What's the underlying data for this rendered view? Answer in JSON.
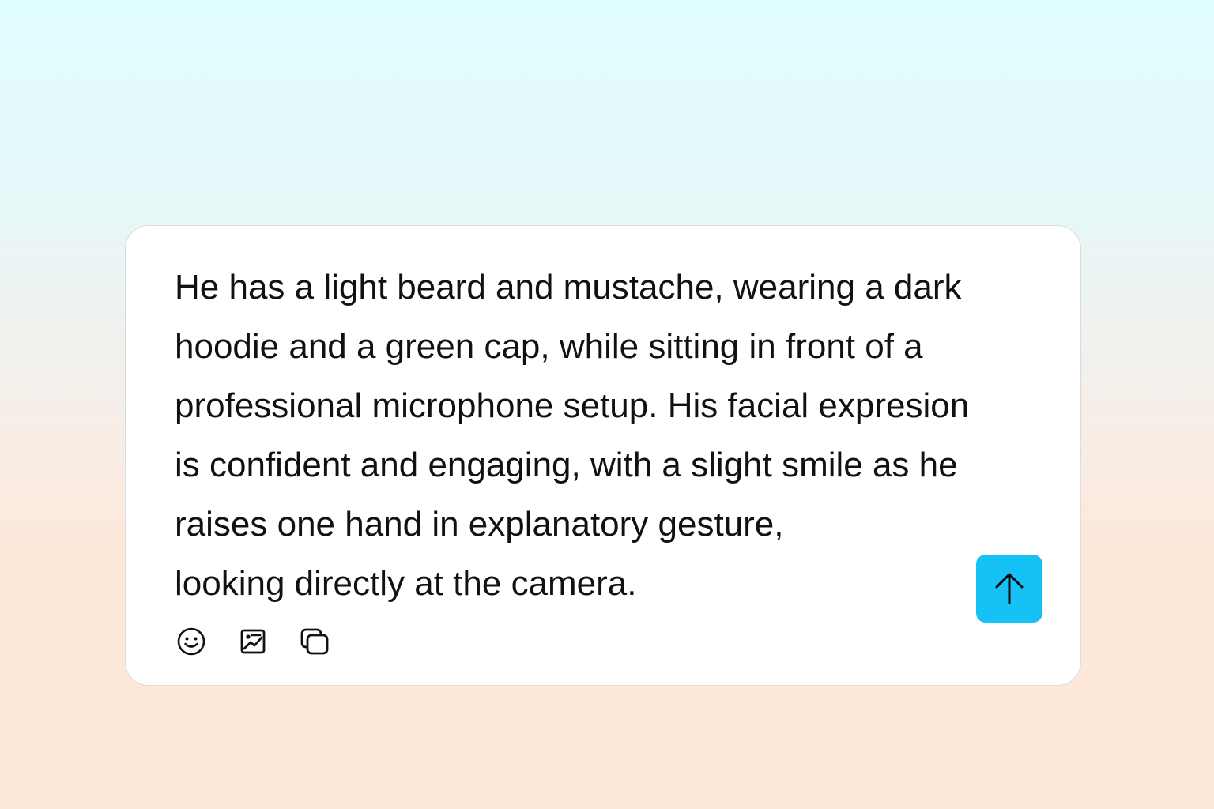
{
  "composer": {
    "prompt_lines": [
      "He has a light beard and mustache, wearing a dark",
      "hoodie and a green cap, while sitting in front of a",
      "professional microphone setup. His facial expresion",
      "is confident and engaging, with a slight smile as he",
      "raises one hand in explanatory gesture,",
      "looking directly at the camera."
    ],
    "toolbar": [
      {
        "icon": "emoji-icon"
      },
      {
        "icon": "image-icon"
      },
      {
        "icon": "copy-icon"
      }
    ],
    "send_icon": "arrow-up-icon"
  },
  "colors": {
    "background_top": "#e0fdff",
    "background_bottom": "#fde7d9",
    "send_button": "#15c1f5",
    "text": "#111111"
  }
}
